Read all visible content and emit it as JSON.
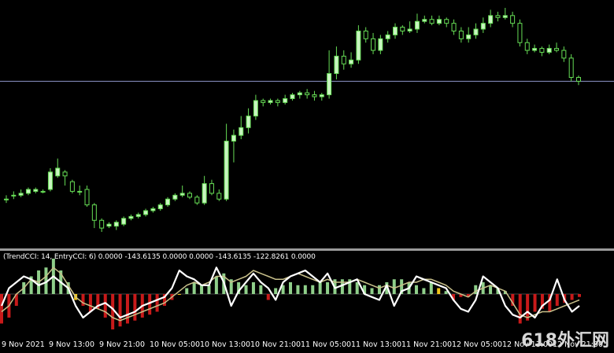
{
  "indicator": {
    "label": "(TrendCCI: 14, EntryCCI: 6)  0.0000 -143.6135 0.0000 0.0000 -143.6135 -122.8261 0.0000"
  },
  "time_axis": [
    "9 Nov 2021",
    "9 Nov 13:00",
    "9 Nov 21:00",
    "10 Nov 05:00",
    "10 Nov 13:00",
    "10 Nov 21:00",
    "11 Nov 05:00",
    "11 Nov 13:00",
    "11 Nov 21:00",
    "12 Nov 05:00",
    "12 Nov 13:00",
    "12 Nov 21:00"
  ],
  "watermark": "618外汇网",
  "colors": {
    "background": "#000000",
    "bull_candle": "#c8f5c0",
    "wick": "#66dd55",
    "price_line": "#8e95c8",
    "bar_green": "#8fcf8a",
    "bar_red": "#c81a1a",
    "bar_yellow": "#f0c419",
    "entry_line": "#ffffff",
    "trend_line": "#c8c08a"
  },
  "chart_data": {
    "type": "candlestick",
    "candles": [
      [
        1,
        1,
        -1,
        3
      ],
      [
        3,
        3,
        1,
        5
      ],
      [
        3,
        4,
        2,
        6
      ],
      [
        4,
        6,
        3,
        7
      ],
      [
        5,
        6,
        4,
        7
      ],
      [
        5,
        5,
        4,
        6
      ],
      [
        6,
        15,
        5,
        17
      ],
      [
        13,
        17,
        12,
        22
      ],
      [
        15,
        13,
        8,
        16
      ],
      [
        10,
        5,
        4,
        11
      ],
      [
        5,
        5,
        3,
        8
      ],
      [
        6,
        -2,
        -3,
        8
      ],
      [
        -2,
        -10,
        -14,
        -1
      ],
      [
        -10,
        -14,
        -16,
        -9
      ],
      [
        -13,
        -12,
        -14,
        -11
      ],
      [
        -13,
        -11,
        -15,
        -10
      ],
      [
        -12,
        -9,
        -13,
        -8
      ],
      [
        -9,
        -8,
        -10,
        -7
      ],
      [
        -8,
        -7,
        -9,
        -6
      ],
      [
        -7,
        -5,
        -8,
        -4
      ],
      [
        -5,
        -4,
        -6,
        -3
      ],
      [
        -4,
        -2,
        -5,
        -1
      ],
      [
        -2,
        1,
        -3,
        2
      ],
      [
        1,
        3,
        0,
        4
      ],
      [
        3,
        4,
        2,
        8
      ],
      [
        4,
        2,
        1,
        5
      ],
      [
        2,
        -1,
        -2,
        3
      ],
      [
        -1,
        9,
        -2,
        13
      ],
      [
        9,
        4,
        3,
        11
      ],
      [
        4,
        1,
        0,
        6
      ],
      [
        1,
        31,
        0,
        40
      ],
      [
        31,
        34,
        20,
        37
      ],
      [
        34,
        38,
        32,
        44
      ],
      [
        38,
        44,
        35,
        48
      ],
      [
        44,
        52,
        42,
        55
      ],
      [
        52,
        51,
        49,
        53
      ],
      [
        51,
        52,
        50,
        53
      ],
      [
        52,
        51,
        49,
        53
      ],
      [
        51,
        53,
        50,
        55
      ],
      [
        53,
        55,
        52,
        56
      ],
      [
        55,
        56,
        53,
        57
      ],
      [
        56,
        55,
        53,
        58
      ],
      [
        55,
        54,
        52,
        57
      ],
      [
        54,
        55,
        52,
        56
      ],
      [
        55,
        66,
        53,
        78
      ],
      [
        66,
        75,
        63,
        80
      ],
      [
        75,
        71,
        68,
        78
      ],
      [
        71,
        73,
        69,
        77
      ],
      [
        73,
        88,
        71,
        91
      ],
      [
        88,
        84,
        82,
        90
      ],
      [
        84,
        78,
        76,
        87
      ],
      [
        78,
        84,
        76,
        86
      ],
      [
        84,
        86,
        82,
        88
      ],
      [
        86,
        90,
        84,
        92
      ],
      [
        90,
        88,
        86,
        91
      ],
      [
        88,
        89,
        87,
        93
      ],
      [
        89,
        93,
        87,
        97
      ],
      [
        93,
        94,
        92,
        96
      ],
      [
        94,
        92,
        91,
        96
      ],
      [
        92,
        94,
        91,
        96
      ],
      [
        94,
        92,
        90,
        95
      ],
      [
        92,
        88,
        86,
        94
      ],
      [
        88,
        84,
        82,
        90
      ],
      [
        84,
        86,
        82,
        90
      ],
      [
        86,
        89,
        84,
        92
      ],
      [
        89,
        92,
        87,
        95
      ],
      [
        92,
        96,
        90,
        99
      ],
      [
        96,
        95,
        93,
        98
      ],
      [
        95,
        96,
        94,
        100
      ],
      [
        96,
        92,
        90,
        98
      ],
      [
        92,
        82,
        80,
        94
      ],
      [
        82,
        78,
        76,
        84
      ],
      [
        78,
        79,
        77,
        81
      ],
      [
        79,
        77,
        75,
        80
      ],
      [
        77,
        79,
        76,
        81
      ],
      [
        79,
        78,
        77,
        82
      ],
      [
        78,
        74,
        72,
        80
      ],
      [
        74,
        64,
        62,
        76
      ],
      [
        64,
        62,
        60,
        65
      ]
    ],
    "price_level": 62,
    "histogram": [
      -50,
      -40,
      -20,
      20,
      30,
      40,
      45,
      60,
      40,
      20,
      -10,
      -20,
      -30,
      -25,
      -40,
      -60,
      -55,
      -50,
      -45,
      -40,
      -35,
      -30,
      -20,
      -10,
      0,
      10,
      20,
      15,
      15,
      30,
      35,
      25,
      20,
      15,
      20,
      15,
      -10,
      10,
      15,
      20,
      15,
      15,
      15,
      20,
      20,
      25,
      25,
      25,
      20,
      15,
      10,
      15,
      20,
      25,
      25,
      20,
      15,
      10,
      20,
      10,
      5,
      -10,
      -5,
      -5,
      15,
      20,
      15,
      10,
      5,
      -20,
      -50,
      -45,
      -30,
      -25,
      -30,
      -20,
      -15,
      -10,
      -5
    ],
    "entry_cci": [
      -20,
      10,
      20,
      30,
      25,
      15,
      20,
      30,
      20,
      10,
      -20,
      -40,
      -30,
      -20,
      -15,
      -25,
      -40,
      -35,
      -30,
      -20,
      -15,
      -10,
      -5,
      10,
      40,
      30,
      25,
      15,
      15,
      45,
      20,
      -20,
      5,
      20,
      35,
      20,
      10,
      -10,
      20,
      30,
      35,
      40,
      30,
      20,
      35,
      10,
      15,
      20,
      25,
      0,
      -5,
      -10,
      15,
      -20,
      5,
      10,
      30,
      25,
      20,
      15,
      10,
      -10,
      -25,
      -30,
      -10,
      30,
      20,
      10,
      -20,
      -35,
      -40,
      -30,
      -40,
      -20,
      -10,
      25,
      -10,
      -30,
      -20
    ],
    "trend_cci": [
      -30,
      -20,
      0,
      10,
      25,
      20,
      30,
      45,
      35,
      15,
      -5,
      -15,
      -20,
      -25,
      -30,
      -40,
      -45,
      -40,
      -35,
      -30,
      -25,
      -20,
      -15,
      -5,
      5,
      15,
      20,
      15,
      20,
      30,
      30,
      20,
      25,
      30,
      40,
      35,
      30,
      25,
      25,
      30,
      35,
      30,
      25,
      20,
      25,
      20,
      20,
      20,
      25,
      20,
      15,
      10,
      15,
      10,
      15,
      20,
      20,
      25,
      25,
      20,
      15,
      5,
      0,
      -5,
      5,
      10,
      15,
      10,
      5,
      -15,
      -35,
      -40,
      -35,
      -30,
      -30,
      -25,
      -20,
      -15,
      -10
    ],
    "histogram_colors": "sign"
  }
}
